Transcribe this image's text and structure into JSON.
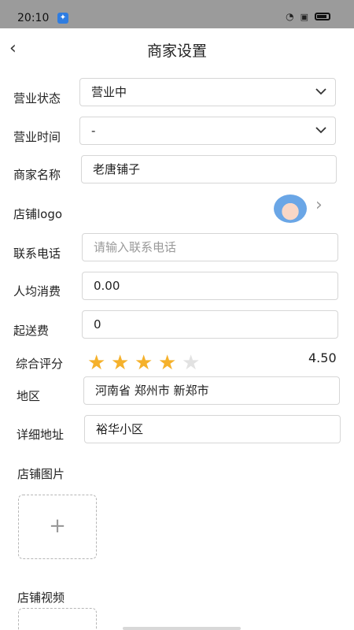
{
  "status": {
    "time": "20:10"
  },
  "header": {
    "title": "商家设置"
  },
  "form": {
    "business_status": {
      "label": "营业状态",
      "value": "营业中"
    },
    "business_hours": {
      "label": "营业时间",
      "value": "-"
    },
    "merchant_name": {
      "label": "商家名称",
      "value": "老唐铺子"
    },
    "store_logo": {
      "label": "店铺logo"
    },
    "contact_phone": {
      "label": "联系电话",
      "placeholder": "请输入联系电话",
      "value": ""
    },
    "avg_spend": {
      "label": "人均消费",
      "value": "0.00"
    },
    "min_delivery": {
      "label": "起送费",
      "value": "0"
    },
    "rating": {
      "label": "综合评分",
      "value": "4.50",
      "stars": 4,
      "max": 5
    },
    "region": {
      "label": "地区",
      "value": "河南省 郑州市 新郑市"
    },
    "address": {
      "label": "详细地址",
      "value": "裕华小区"
    },
    "store_images": {
      "label": "店铺图片",
      "add_symbol": "+"
    },
    "store_video": {
      "label": "店铺视频"
    }
  },
  "icons": {
    "back": "chevron-left-icon",
    "dropdown": "chevron-down-icon",
    "logo_arrow": "chevron-right-icon",
    "star_active_color": "#f5b12b",
    "star_inactive_color": "#e2e2e2"
  }
}
